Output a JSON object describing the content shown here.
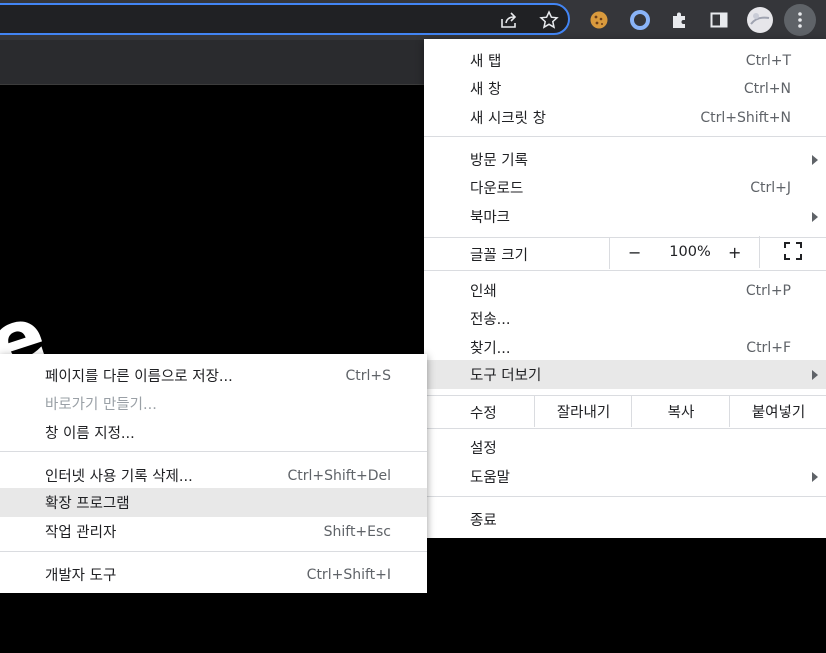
{
  "toolbar": {
    "icons": [
      "share-icon",
      "star-icon",
      "cookie-extension-icon",
      "circle-extension-icon",
      "extensions-puzzle-icon",
      "side-panel-icon",
      "profile-avatar",
      "menu-kebab-icon"
    ]
  },
  "main_menu": {
    "new_tab": {
      "label": "새 탭",
      "shortcut": "Ctrl+T"
    },
    "new_window": {
      "label": "새 창",
      "shortcut": "Ctrl+N"
    },
    "new_incognito": {
      "label": "새 시크릿 창",
      "shortcut": "Ctrl+Shift+N"
    },
    "history": {
      "label": "방문 기록"
    },
    "downloads": {
      "label": "다운로드",
      "shortcut": "Ctrl+J"
    },
    "bookmarks": {
      "label": "북마크"
    },
    "zoom": {
      "label": "글꼴 크기",
      "minus": "−",
      "value": "100%",
      "plus": "+"
    },
    "print": {
      "label": "인쇄",
      "shortcut": "Ctrl+P"
    },
    "cast": {
      "label": "전송..."
    },
    "find": {
      "label": "찾기...",
      "shortcut": "Ctrl+F"
    },
    "more_tools": {
      "label": "도구 더보기"
    },
    "edit": {
      "label": "수정",
      "cut": "잘라내기",
      "copy": "복사",
      "paste": "붙여넣기"
    },
    "settings": {
      "label": "설정"
    },
    "help": {
      "label": "도움말"
    },
    "exit": {
      "label": "종료"
    }
  },
  "sub_menu": {
    "save_as": {
      "label": "페이지를 다른 이름으로 저장...",
      "shortcut": "Ctrl+S"
    },
    "create_shortcut": {
      "label": "바로가기 만들기..."
    },
    "name_window": {
      "label": "창 이름 지정..."
    },
    "clear_data": {
      "label": "인터넷 사용 기록 삭제...",
      "shortcut": "Ctrl+Shift+Del"
    },
    "extensions": {
      "label": "확장 프로그램"
    },
    "task_manager": {
      "label": "작업 관리자",
      "shortcut": "Shift+Esc"
    },
    "dev_tools": {
      "label": "개발자 도구",
      "shortcut": "Ctrl+Shift+I"
    }
  }
}
